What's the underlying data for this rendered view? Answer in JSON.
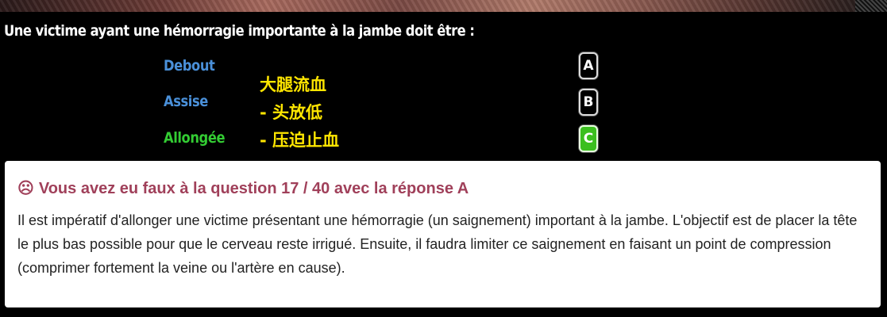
{
  "question": "Une victime ayant une hémorragie importante à la jambe doit être :",
  "answers": [
    {
      "text": "Debout",
      "letter": "A"
    },
    {
      "text": "Assise",
      "letter": "B"
    },
    {
      "text": "Allongée",
      "letter": "C"
    }
  ],
  "note": {
    "line1": "大腿流血",
    "line2": "- 头放低",
    "line3": "- 压迫止血"
  },
  "feedback": {
    "icon": "sad-face-icon",
    "icon_glyph": "☹",
    "title": "Vous avez eu faux à la question 17 / 40 avec la réponse A",
    "text": "Il est impératif d'allonger une victime présentant une hémorragie (un saignement) important à la jambe. L'objectif est de placer la tête le plus bas possible pour que le cerveau reste irrigué. Ensuite, il faudra limiter ce saignement en faisant un point de compression (comprimer fortement la veine ou l'artère en cause)."
  },
  "colors": {
    "answer_default": "#4a90d9",
    "answer_correct": "#33cc33",
    "note": "#ffe600",
    "feedback_title": "#a0405a",
    "correct_button": "#3bbf1f"
  }
}
